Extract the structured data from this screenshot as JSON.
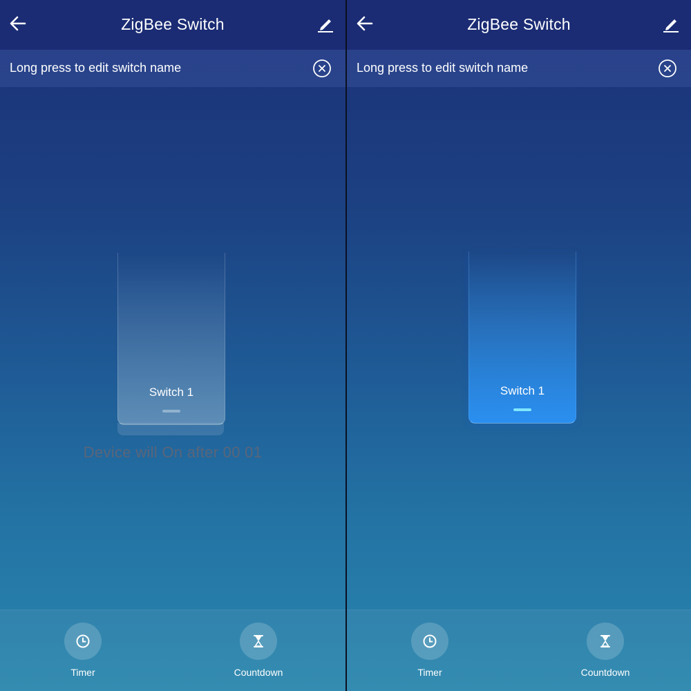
{
  "screens": [
    {
      "header": {
        "title": "ZigBee Switch"
      },
      "notice": {
        "text": "Long press to edit switch name"
      },
      "switch": {
        "label": "Switch 1",
        "state": "off"
      },
      "status": {
        "text": "Device will On after 00 01"
      },
      "actions": [
        {
          "label": "Timer",
          "icon": "clock-icon"
        },
        {
          "label": "Countdown",
          "icon": "hourglass-icon"
        }
      ]
    },
    {
      "header": {
        "title": "ZigBee Switch"
      },
      "notice": {
        "text": "Long press to edit switch name"
      },
      "switch": {
        "label": "Switch 1",
        "state": "on"
      },
      "actions": [
        {
          "label": "Timer",
          "icon": "clock-icon"
        },
        {
          "label": "Countdown",
          "icon": "hourglass-icon"
        }
      ]
    }
  ],
  "colors": {
    "header_bg": "#1b2c74",
    "switch_on": "#2b8ff0",
    "indicator_on": "#7fe6ff"
  }
}
